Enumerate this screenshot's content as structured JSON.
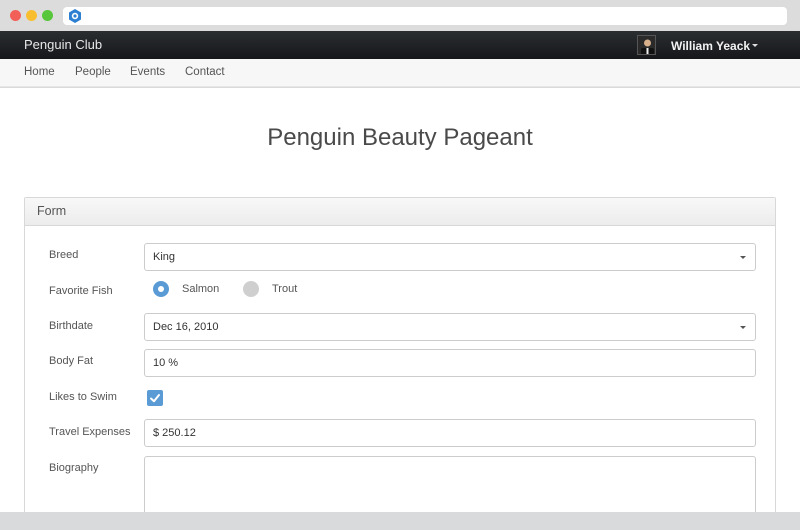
{
  "app": {
    "brand": "Penguin Club",
    "user_name": "William Yeack"
  },
  "nav": {
    "items": [
      {
        "label": "Home"
      },
      {
        "label": "People"
      },
      {
        "label": "Events"
      },
      {
        "label": "Contact"
      }
    ]
  },
  "page": {
    "title": "Penguin Beauty Pageant"
  },
  "form": {
    "panel_title": "Form",
    "breed": {
      "label": "Breed",
      "value": "King"
    },
    "favorite_fish": {
      "label": "Favorite Fish",
      "options": [
        "Salmon",
        "Trout"
      ],
      "selected": "Salmon"
    },
    "birthdate": {
      "label": "Birthdate",
      "value": "Dec 16, 2010"
    },
    "body_fat": {
      "label": "Body Fat",
      "value": "10 %"
    },
    "likes_to_swim": {
      "label": "Likes to Swim",
      "checked": true
    },
    "travel_expenses": {
      "label": "Travel Expenses",
      "value": "$ 250.12"
    },
    "biography": {
      "label": "Biography",
      "value": ""
    }
  },
  "colors": {
    "accent": "#5b9bd5",
    "navbar": "#1f2225"
  }
}
